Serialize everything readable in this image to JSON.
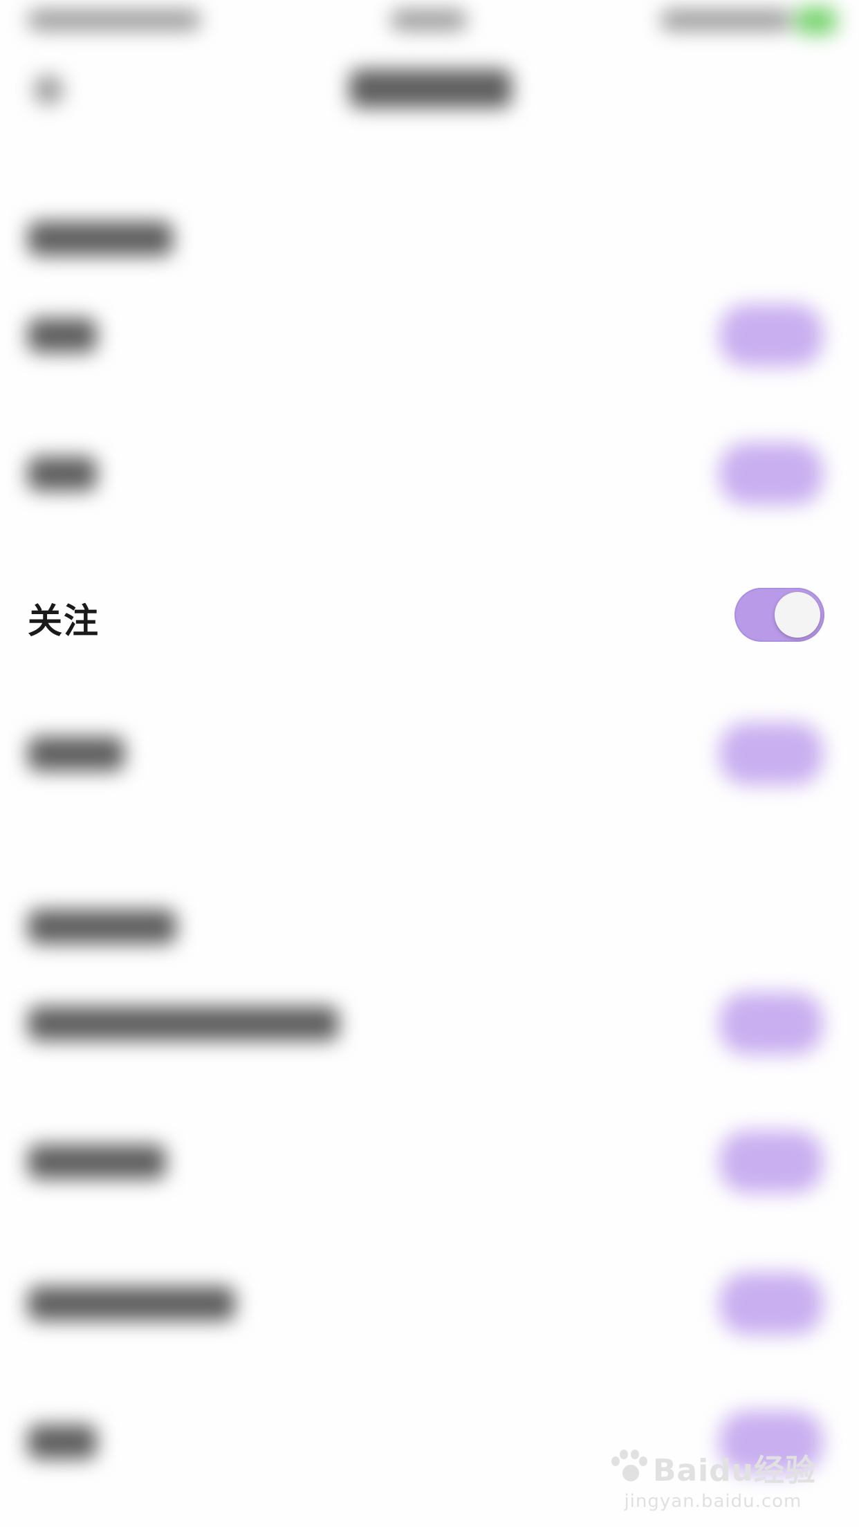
{
  "setting": {
    "label": "关注",
    "toggle_state": "on",
    "toggle_color": "#b99ae8"
  },
  "watermark": {
    "brand_text": "Baidu经验",
    "url_text": "jingyan.baidu.com"
  },
  "icons": [
    "back-arrow-icon",
    "toggle-switch-icon",
    "baidu-paw-icon"
  ],
  "colors": {
    "background": "#fefefe",
    "accent_purple": "#b99ae8",
    "status_green": "#77d36e"
  }
}
